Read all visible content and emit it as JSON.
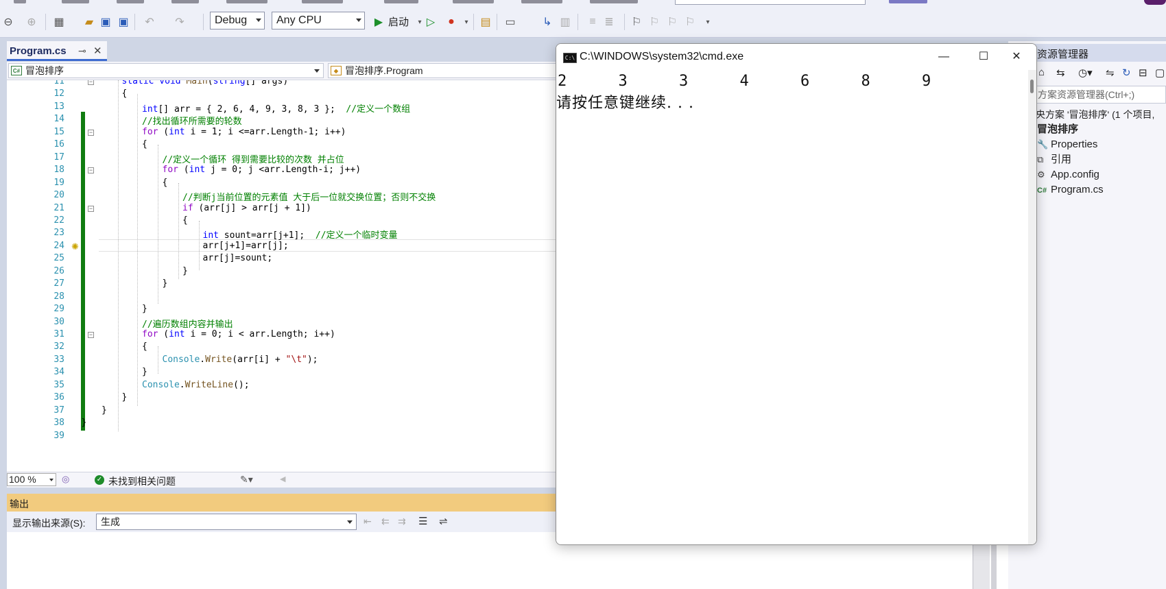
{
  "toolbar": {
    "config": "Debug",
    "platform": "Any CPU",
    "start_label": "启动"
  },
  "editor": {
    "tab_name": "Program.cs",
    "nav_project": "冒泡排序",
    "nav_class": "冒泡排序.Program",
    "zoom": "100 %",
    "status": "未找到相关问题",
    "lines": [
      {
        "n": "11",
        "t": "static void Main(string[] args)"
      },
      {
        "n": "12",
        "t": "{"
      },
      {
        "n": "13",
        "t": "int[] arr = { 2, 6, 4, 9, 3, 8, 3 };  //定义一个数组"
      },
      {
        "n": "14",
        "t": "//找出循环所需要的轮数"
      },
      {
        "n": "15",
        "t": "for (int i = 1; i <=arr.Length-1; i++)"
      },
      {
        "n": "16",
        "t": "{"
      },
      {
        "n": "17",
        "t": "//定义一个循环 得到需要比较的次数 并占位"
      },
      {
        "n": "18",
        "t": "for (int j = 0; j <arr.Length-i; j++)"
      },
      {
        "n": "19",
        "t": "{"
      },
      {
        "n": "20",
        "t": "//判断j当前位置的元素值 大于后一位就交换位置；否则不交换"
      },
      {
        "n": "21",
        "t": "if (arr[j] > arr[j + 1])"
      },
      {
        "n": "22",
        "t": "{"
      },
      {
        "n": "23",
        "t": "int sount=arr[j+1];  //定义一个临时变量"
      },
      {
        "n": "24",
        "t": "arr[j+1]=arr[j];"
      },
      {
        "n": "25",
        "t": "arr[j]=sount;"
      },
      {
        "n": "26",
        "t": "}"
      },
      {
        "n": "27",
        "t": "}"
      },
      {
        "n": "28",
        "t": ""
      },
      {
        "n": "29",
        "t": "}"
      },
      {
        "n": "30",
        "t": "//遍历数组内容并输出"
      },
      {
        "n": "31",
        "t": "for (int i = 0; i < arr.Length; i++)"
      },
      {
        "n": "32",
        "t": "{"
      },
      {
        "n": "33",
        "t": "Console.Write(arr[i] + \"\\t\");"
      },
      {
        "n": "34",
        "t": "}"
      },
      {
        "n": "35",
        "t": "Console.WriteLine();"
      },
      {
        "n": "36",
        "t": "}"
      },
      {
        "n": "37",
        "t": "}"
      },
      {
        "n": "38",
        "t": "}"
      },
      {
        "n": "39",
        "t": ""
      }
    ]
  },
  "output": {
    "title": "输出",
    "source_label": "显示输出来源(S):",
    "source_value": "生成"
  },
  "solution_explorer": {
    "title": "资源管理器",
    "search_placeholder": "方案资源管理器(Ctrl+;)",
    "solution": "央方案 '冒泡排序' (1 个项目,",
    "project": "冒泡排序",
    "items": [
      "Properties",
      "引用",
      "App.config",
      "Program.cs"
    ]
  },
  "cmd": {
    "title": "C:\\WINDOWS\\system32\\cmd.exe",
    "numbers": [
      "2",
      "3",
      "3",
      "4",
      "6",
      "8",
      "9"
    ],
    "prompt": "请按任意键继续. . ."
  }
}
